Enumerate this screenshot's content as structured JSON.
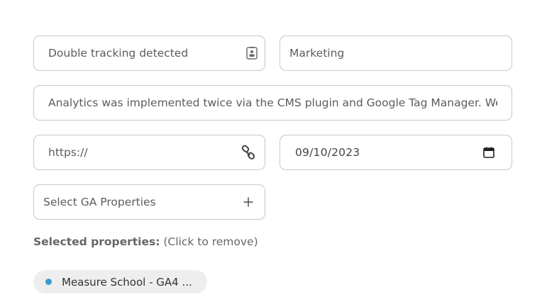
{
  "form": {
    "title": {
      "value": "Double tracking detected",
      "icon": "contact-card-icon"
    },
    "category": {
      "value": "Marketing"
    },
    "description": {
      "value": "Analytics was implemented twice via the CMS plugin and Google Tag Manager. We decic"
    },
    "url": {
      "placeholder": "https://",
      "icon": "link-icon"
    },
    "date": {
      "value": "09/10/2023",
      "icon": "calendar-icon"
    },
    "ga_select": {
      "placeholder": "Select GA Properties",
      "icon": "plus-icon"
    }
  },
  "selected": {
    "label": "Selected properties:",
    "hint": "(Click to remove)",
    "chips": [
      {
        "label": "Measure School - GA4 ...",
        "dot_color": "#3b9ad0"
      }
    ]
  },
  "colors": {
    "border": "#c7c7c7",
    "chip_background": "#eeeeee",
    "text": "#5c5c5c"
  }
}
